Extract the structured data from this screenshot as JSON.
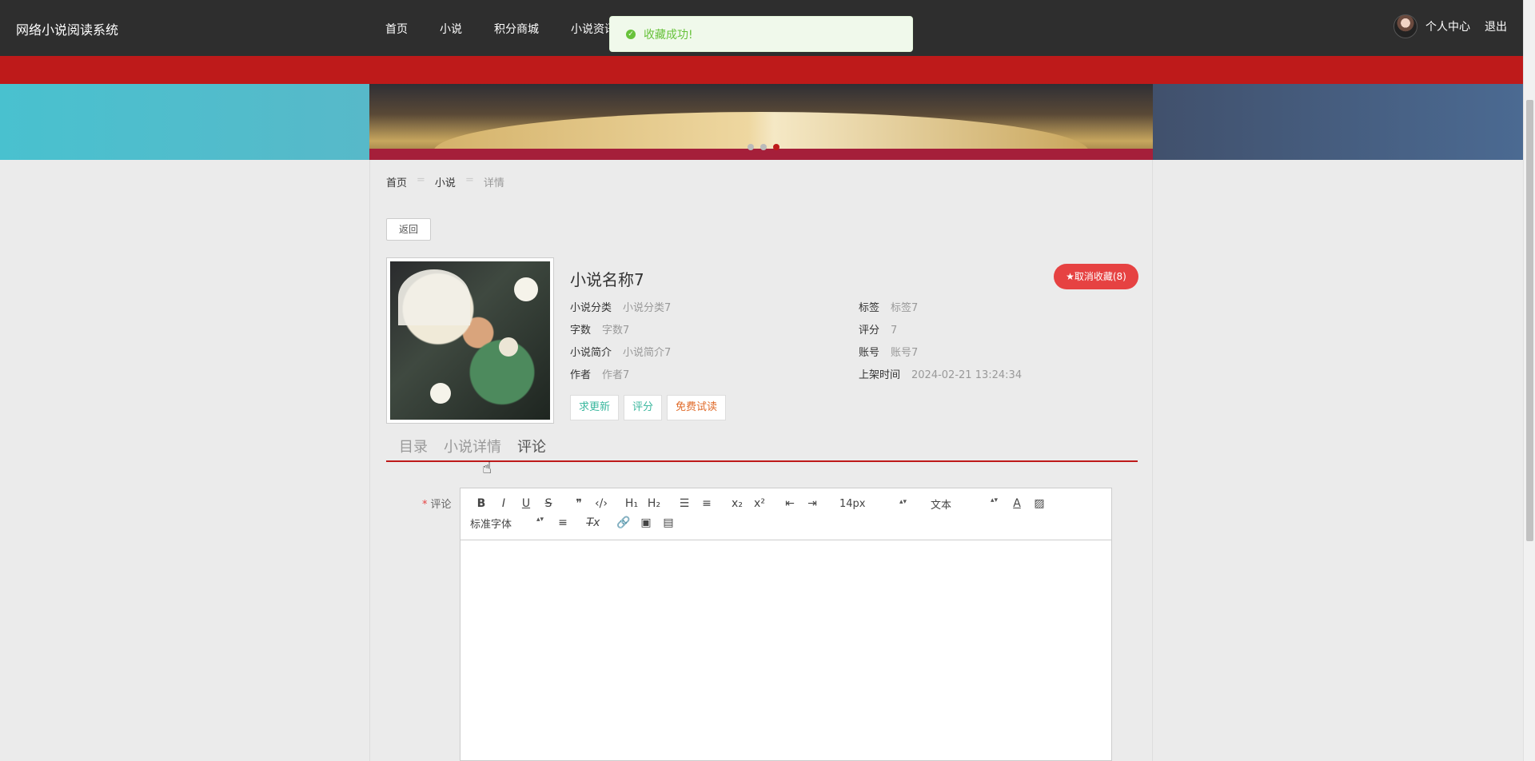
{
  "header": {
    "brand": "网络小说阅读系统",
    "nav": [
      "首页",
      "小说",
      "积分商城",
      "小说资讯"
    ],
    "user_center": "个人中心",
    "logout": "退出"
  },
  "toast": {
    "message": "收藏成功!"
  },
  "carousel": {
    "slides": 3,
    "active_index": 2
  },
  "breadcrumb": {
    "home": "首页",
    "sep": "=",
    "mid": "小说",
    "current": "详情"
  },
  "back_label": "返回",
  "novel": {
    "title": "小说名称7",
    "fav_label": "★取消收藏(8)",
    "fields_left": [
      {
        "k": "小说分类",
        "v": "小说分类7"
      },
      {
        "k": "字数",
        "v": "字数7"
      },
      {
        "k": "小说简介",
        "v": "小说简介7"
      },
      {
        "k": "作者",
        "v": "作者7"
      }
    ],
    "fields_right": [
      {
        "k": "标签",
        "v": "标签7"
      },
      {
        "k": "评分",
        "v": "7"
      },
      {
        "k": "账号",
        "v": "账号7"
      },
      {
        "k": "上架时间",
        "v": "2024-02-21 13:24:34"
      }
    ],
    "actions": [
      "求更新",
      "评分",
      "免费试读"
    ]
  },
  "tabs": [
    "目录",
    "小说详情",
    "评论"
  ],
  "active_tab": 2,
  "comment_form": {
    "required_mark": "*",
    "label": "评论",
    "font_size": "14px",
    "block_type": "文本",
    "font_family": "标准字体"
  },
  "colors": {
    "accent": "#be1a1a",
    "fav": "#e64242",
    "success": "#67c23a"
  }
}
